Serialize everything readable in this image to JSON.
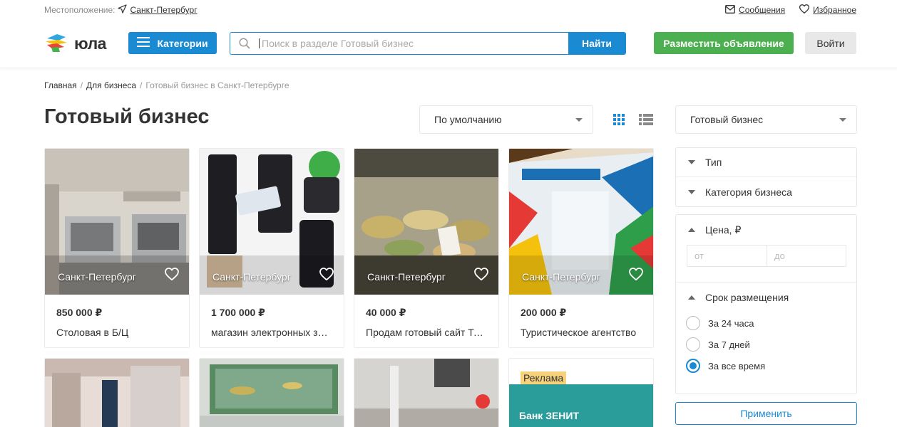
{
  "topbar": {
    "location_label": "Местоположение:",
    "city": "Санкт-Петербург",
    "messages": "Сообщения",
    "favorites": "Избранное"
  },
  "header": {
    "logo_text": "юла",
    "categories_label": "Категории",
    "search_placeholder": "Поиск в разделе Готовый бизнес",
    "search_value": "",
    "find_label": "Найти",
    "post_ad_label": "Разместить объявление",
    "login_label": "Войти"
  },
  "breadcrumb": {
    "items": [
      "Главная",
      "Для бизнеса",
      "Готовый бизнес в Санкт-Петербурге"
    ],
    "separator": "/"
  },
  "page": {
    "title": "Готовый бизнес",
    "sort_value": "По умолчанию"
  },
  "listings": [
    {
      "city": "Санкт-Петербург",
      "price": "850 000 ₽",
      "title": "Столовая в Б/Ц"
    },
    {
      "city": "Санкт-Петербург",
      "price": "1 700 000 ₽",
      "title": "магазин электронных замков"
    },
    {
      "city": "Санкт-Петербург",
      "price": "40 000 ₽",
      "title": "Продам готовый сайт Тортики"
    },
    {
      "city": "Санкт-Петербург",
      "price": "200 000 ₽",
      "title": "Туристическое агентство"
    }
  ],
  "ad": {
    "badge": "Реклама",
    "text": "Банк ЗЕНИТ"
  },
  "filters": {
    "category_select": "Готовый бизнес",
    "type_label": "Тип",
    "business_category_label": "Категория бизнеса",
    "price_label": "Цена, ₽",
    "price_from_placeholder": "от",
    "price_to_placeholder": "до",
    "period_label": "Срок размещения",
    "period_options": [
      "За 24 часа",
      "За 7 дней",
      "За все время"
    ],
    "period_selected": "За все время",
    "apply_label": "Применить"
  },
  "colors": {
    "primary": "#1a8ad3",
    "post_button": "#4caf50",
    "login_button": "#e8e8e8"
  }
}
